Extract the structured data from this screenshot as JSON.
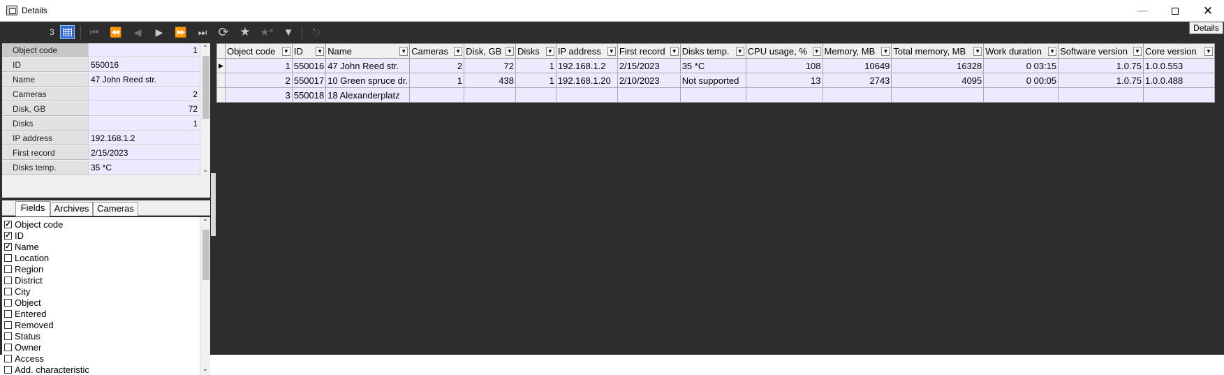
{
  "window": {
    "title": "Details",
    "details_button": "Details"
  },
  "toolbar": {
    "record_count": "3"
  },
  "properties": {
    "rows": [
      {
        "label": "Object code",
        "value": "1",
        "num": true
      },
      {
        "label": "ID",
        "value": "550016",
        "num": false
      },
      {
        "label": "Name",
        "value": "47 John Reed str.",
        "num": false
      },
      {
        "label": "Cameras",
        "value": "2",
        "num": true
      },
      {
        "label": "Disk, GB",
        "value": "72",
        "num": true
      },
      {
        "label": "Disks",
        "value": "1",
        "num": true
      },
      {
        "label": "IP address",
        "value": "192.168.1.2",
        "num": false
      },
      {
        "label": "First record",
        "value": "2/15/2023",
        "num": false
      },
      {
        "label": "Disks temp.",
        "value": "35 *C",
        "num": false
      }
    ]
  },
  "tabs": [
    "Fields",
    "Archives",
    "Cameras"
  ],
  "fields": [
    {
      "label": "Object code",
      "checked": true
    },
    {
      "label": "ID",
      "checked": true
    },
    {
      "label": "Name",
      "checked": true
    },
    {
      "label": "Location",
      "checked": false
    },
    {
      "label": "Region",
      "checked": false
    },
    {
      "label": "District",
      "checked": false
    },
    {
      "label": "City",
      "checked": false
    },
    {
      "label": "Object",
      "checked": false
    },
    {
      "label": "Entered",
      "checked": false
    },
    {
      "label": "Removed",
      "checked": false
    },
    {
      "label": "Status",
      "checked": false
    },
    {
      "label": "Owner",
      "checked": false
    },
    {
      "label": "Access",
      "checked": false
    },
    {
      "label": "Add. characteristic",
      "checked": false
    }
  ],
  "grid": {
    "columns": [
      "Object code",
      "ID",
      "Name",
      "Cameras",
      "Disk, GB",
      "Disks",
      "IP address",
      "First record",
      "Disks temp.",
      "CPU usage, %",
      "Memory, MB",
      "Total memory, MB",
      "Work duration",
      "Software version",
      "Core version"
    ],
    "numeric": [
      true,
      false,
      false,
      true,
      true,
      true,
      false,
      false,
      false,
      true,
      true,
      true,
      true,
      true,
      false
    ],
    "rows": [
      [
        "1",
        "550016",
        "47 John Reed str.",
        "2",
        "72",
        "1",
        "192.168.1.2",
        "2/15/2023",
        "35 *C",
        "108",
        "10649",
        "16328",
        "0 03:15",
        "1.0.75",
        "1.0.0.553"
      ],
      [
        "2",
        "550017",
        "10 Green spruce dr.",
        "1",
        "438",
        "1",
        "192.168.1.20",
        "2/10/2023",
        "Not supported",
        "13",
        "2743",
        "4095",
        "0 00:05",
        "1.0.75",
        "1.0.0.488"
      ],
      [
        "3",
        "550018",
        "18 Alexanderplatz",
        "",
        "",
        "",
        "",
        "",
        "",
        "",
        "",
        "",
        "",
        "",
        ""
      ]
    ]
  }
}
